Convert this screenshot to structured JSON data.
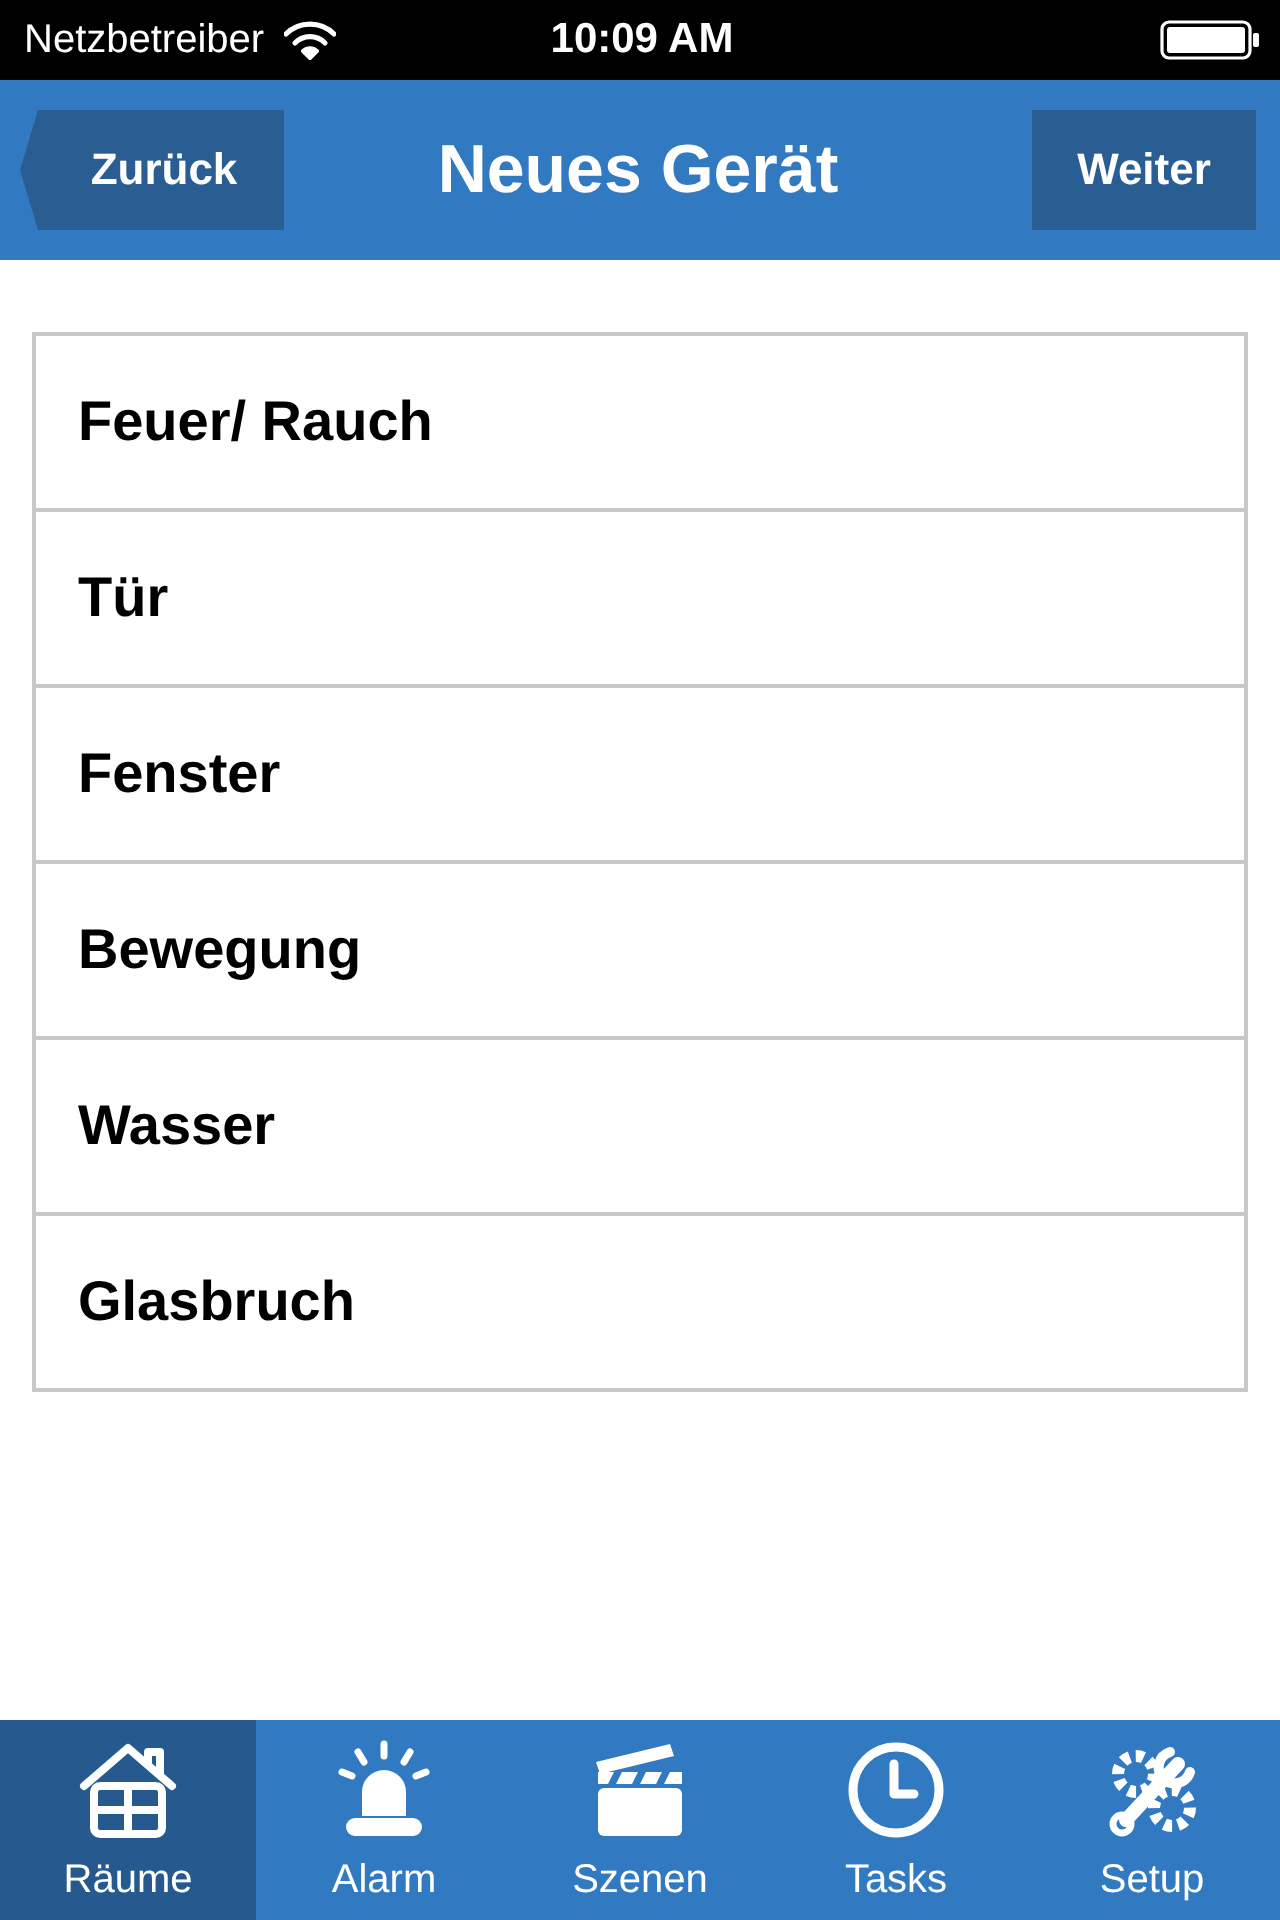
{
  "status_bar": {
    "carrier": "Netzbetreiber",
    "time": "10:09 AM"
  },
  "nav_bar": {
    "back_button": "Zurück",
    "title": "Neues Gerät",
    "next_button": "Weiter"
  },
  "device_types": [
    "Feuer/ Rauch",
    "Tür",
    "Fenster",
    "Bewegung",
    "Wasser",
    "Glasbruch"
  ],
  "tab_bar": [
    {
      "kind": "rooms",
      "label": "Räume",
      "selected": true
    },
    {
      "kind": "alarm",
      "label": "Alarm",
      "selected": false
    },
    {
      "kind": "scenes",
      "label": "Szenen",
      "selected": false
    },
    {
      "kind": "tasks",
      "label": "Tasks",
      "selected": false
    },
    {
      "kind": "setup",
      "label": "Setup",
      "selected": false
    }
  ]
}
